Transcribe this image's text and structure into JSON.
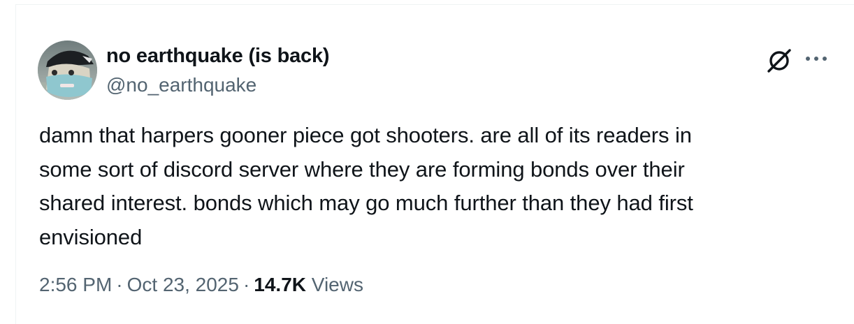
{
  "author": {
    "display_name": "no earthquake (is back)",
    "handle": "@no_earthquake"
  },
  "icons": {
    "avatar": "avatar-photo",
    "grok": "grok-icon",
    "more": "more-options-icon"
  },
  "tweet": {
    "lines": [
      "damn that harpers gooner piece got shooters. are all of its readers in",
      "some sort of discord server where they are forming bonds over their",
      "shared interest. bonds which may go much further than they had first",
      "envisioned"
    ]
  },
  "meta": {
    "time": "2:56 PM",
    "separator": "·",
    "date": "Oct 23, 2025",
    "views_count": "14.7K",
    "views_label": "Views"
  },
  "colors": {
    "text_primary": "#0f1419",
    "text_secondary": "#536471",
    "border": "#eff3f4",
    "background": "#ffffff"
  }
}
